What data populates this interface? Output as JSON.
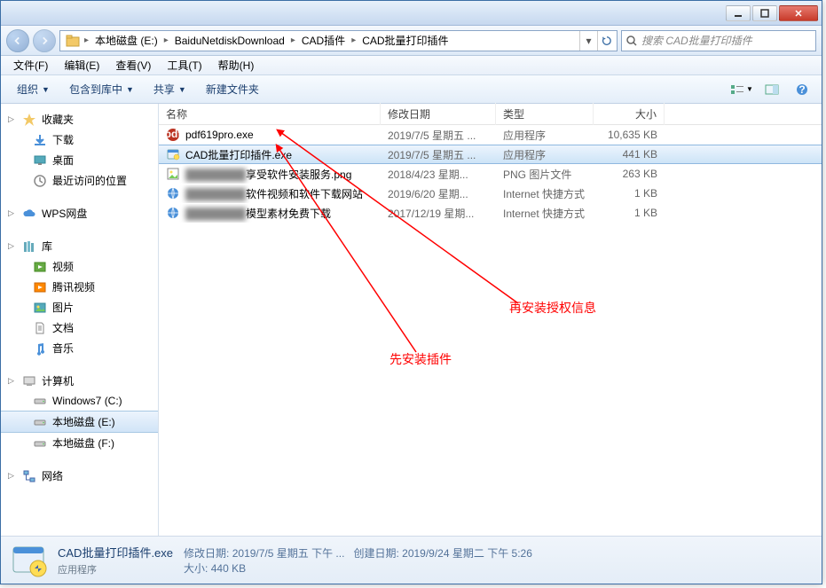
{
  "titlebar": {},
  "breadcrumbs": [
    "本地磁盘 (E:)",
    "BaiduNetdiskDownload",
    "CAD插件",
    "CAD批量打印插件"
  ],
  "search": {
    "placeholder": "搜索 CAD批量打印插件"
  },
  "menu": [
    "文件(F)",
    "编辑(E)",
    "查看(V)",
    "工具(T)",
    "帮助(H)"
  ],
  "toolbar": {
    "organize": "组织",
    "include": "包含到库中",
    "share": "共享",
    "newfolder": "新建文件夹"
  },
  "sidebar": {
    "favorites": {
      "label": "收藏夹",
      "items": [
        {
          "label": "下载"
        },
        {
          "label": "桌面"
        },
        {
          "label": "最近访问的位置"
        }
      ]
    },
    "wps": {
      "label": "WPS网盘"
    },
    "libraries": {
      "label": "库",
      "items": [
        {
          "label": "视频"
        },
        {
          "label": "腾讯视频"
        },
        {
          "label": "图片"
        },
        {
          "label": "文档"
        },
        {
          "label": "音乐"
        }
      ]
    },
    "computer": {
      "label": "计算机",
      "items": [
        {
          "label": "Windows7 (C:)"
        },
        {
          "label": "本地磁盘 (E:)",
          "selected": true
        },
        {
          "label": "本地磁盘 (F:)"
        }
      ]
    },
    "network": {
      "label": "网络"
    }
  },
  "columns": {
    "name": "名称",
    "date": "修改日期",
    "type": "类型",
    "size": "大小"
  },
  "files": [
    {
      "icon": "pdf",
      "name": "pdf619pro.exe",
      "date": "2019/7/5 星期五 ...",
      "type": "应用程序",
      "size": "10,635 KB"
    },
    {
      "icon": "exe",
      "name": "CAD批量打印插件.exe",
      "date": "2019/7/5 星期五 ...",
      "type": "应用程序",
      "size": "441 KB",
      "selected": true
    },
    {
      "icon": "png",
      "name": "享受软件安装服务.png",
      "blur": true,
      "date": "2018/4/23 星期...",
      "type": "PNG 图片文件",
      "size": "263 KB"
    },
    {
      "icon": "url",
      "name": "软件视频和软件下载网站",
      "blur": true,
      "date": "2019/6/20 星期...",
      "type": "Internet 快捷方式",
      "size": "1 KB"
    },
    {
      "icon": "url",
      "name": "模型素材免费下载",
      "blur": true,
      "date": "2017/12/19 星期...",
      "type": "Internet 快捷方式",
      "size": "1 KB"
    }
  ],
  "details": {
    "name": "CAD批量打印插件.exe",
    "type": "应用程序",
    "mod_label": "修改日期:",
    "mod_value": "2019/7/5 星期五 下午 ...",
    "create_label": "创建日期:",
    "create_value": "2019/9/24 星期二 下午 5:26",
    "size_label": "大小:",
    "size_value": "440 KB"
  },
  "annotations": {
    "a1": "先安装插件",
    "a2": "再安装授权信息"
  }
}
